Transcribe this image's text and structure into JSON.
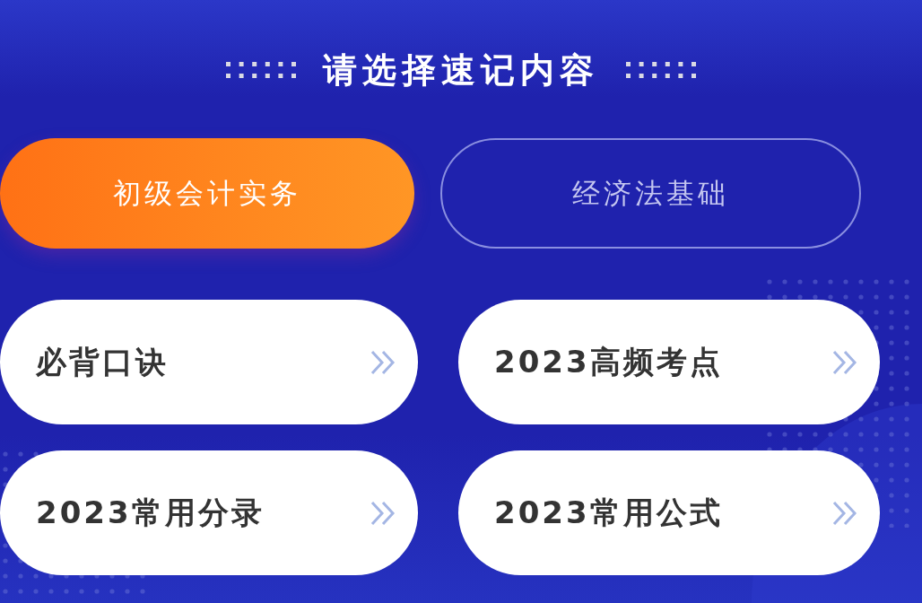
{
  "title": "请选择速记内容",
  "tabs": [
    {
      "label": "初级会计实务",
      "selected": true
    },
    {
      "label": "经济法基础",
      "selected": false
    }
  ],
  "items": [
    {
      "label": "必背口诀"
    },
    {
      "label": "2023高频考点"
    },
    {
      "label": "2023常用分录"
    },
    {
      "label": "2023常用公式"
    }
  ]
}
